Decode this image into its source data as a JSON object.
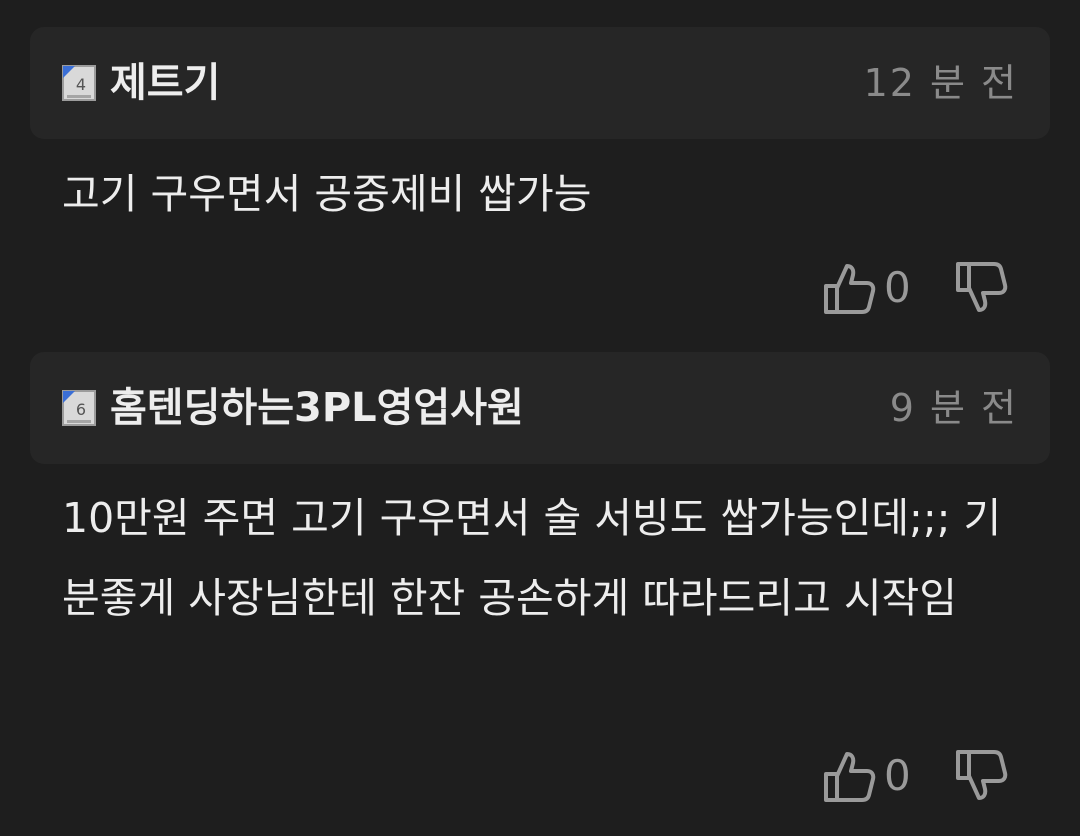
{
  "comments": [
    {
      "level": "4",
      "nickname": "제트기",
      "time": "12 분 전",
      "body": "고기 구우면서 공중제비 쌉가능",
      "likes": "0"
    },
    {
      "level": "6",
      "nickname": "홈텐딩하는3PL영업사원",
      "time": "9 분 전",
      "body": "10만원 주면 고기 구우면서 술 서빙도 쌉가능인데;;; 기분좋게 사장님한테 한잔 공손하게 따라드리고 시작임",
      "likes": "0"
    }
  ],
  "icons": {
    "like": "thumbs-up-icon",
    "dislike": "thumbs-down-icon",
    "level": "level-badge-icon"
  },
  "colors": {
    "background": "#1e1e1e",
    "header_background": "#262626",
    "text": "#ededed",
    "muted": "#8a8a8a",
    "badge_blue": "#3b6fd6"
  }
}
